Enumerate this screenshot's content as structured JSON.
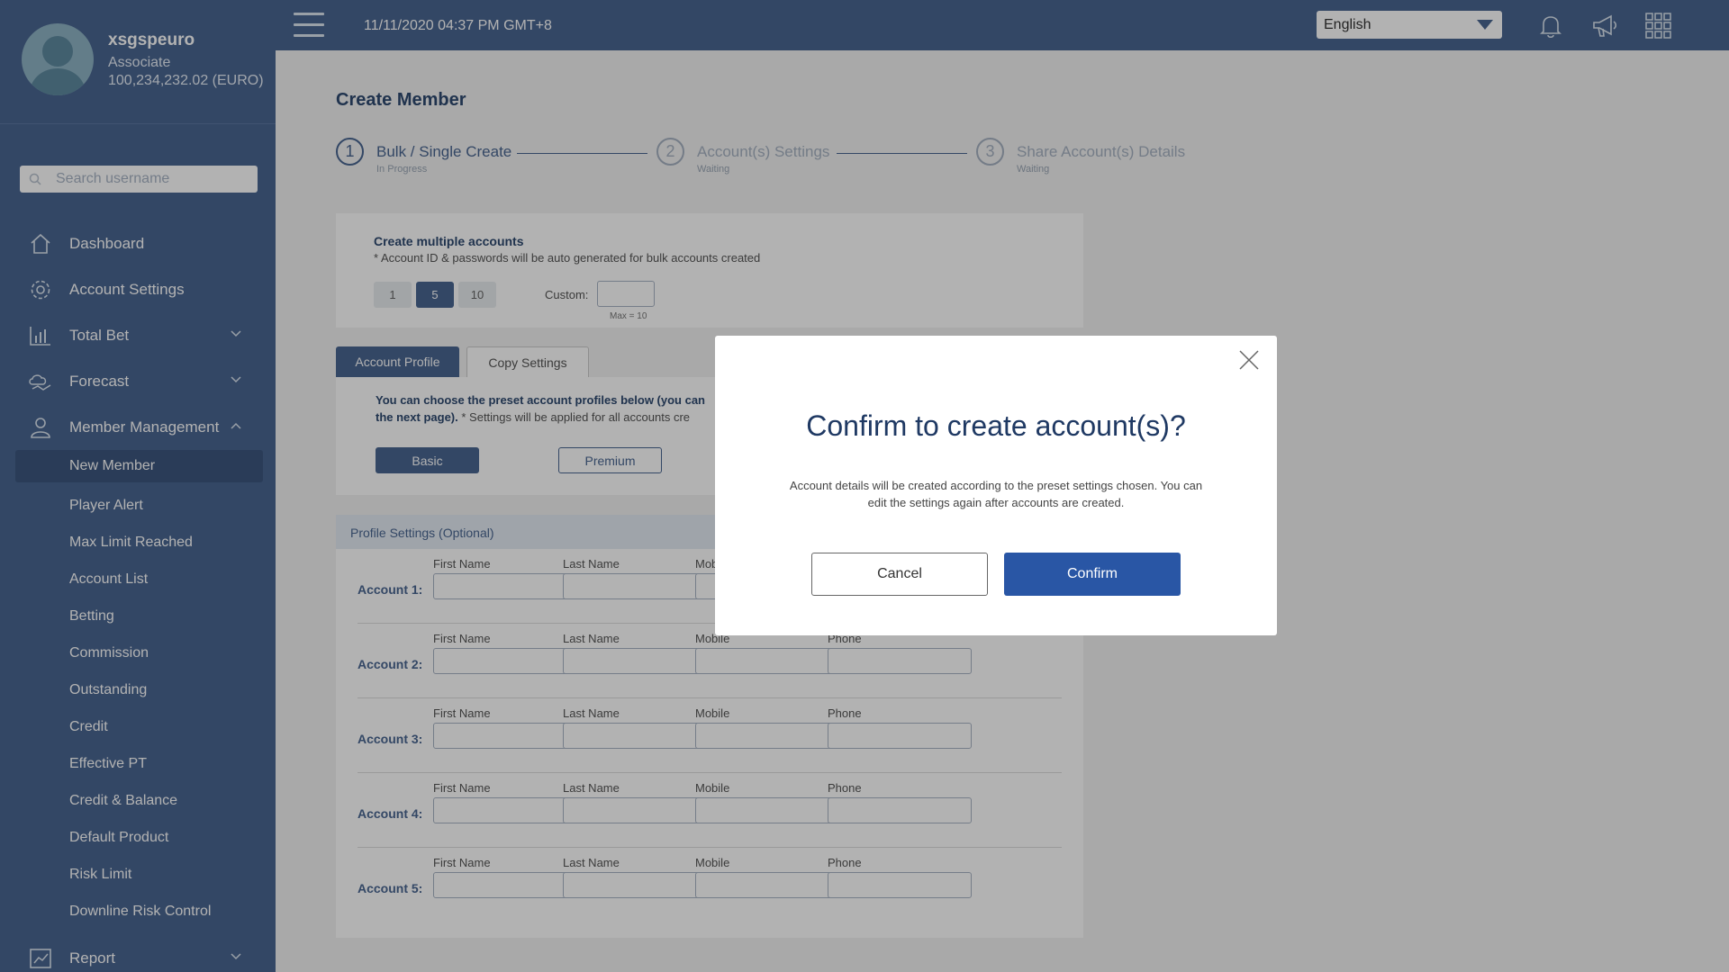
{
  "user": {
    "name": "xsgspeuro",
    "role": "Associate",
    "balance": "100,234,232.02 (EURO)"
  },
  "search": {
    "placeholder": "Search username"
  },
  "nav": {
    "dashboard": "Dashboard",
    "account_settings": "Account Settings",
    "total_bet": "Total Bet",
    "forecast": "Forecast",
    "member_management": "Member Management",
    "report": "Report",
    "sub_items": [
      "New Member",
      "Player Alert",
      "Max Limit Reached",
      "Account List",
      "Betting",
      "Commission",
      "Outstanding",
      "Credit",
      "Effective PT",
      "Credit & Balance",
      "Default Product",
      "Risk Limit",
      "Downline Risk Control"
    ]
  },
  "topbar": {
    "datetime": "11/11/2020 04:37 PM GMT+8",
    "language": "English"
  },
  "page": {
    "title": "Create Member",
    "steps": [
      {
        "number": "1",
        "label": "Bulk / Single Create",
        "status": "In Progress"
      },
      {
        "number": "2",
        "label": "Account(s) Settings",
        "status": "Waiting"
      },
      {
        "number": "3",
        "label": "Share Account(s) Details",
        "status": "Waiting"
      }
    ],
    "bulk": {
      "title": "Create multiple accounts",
      "note": "* Account ID & passwords will be auto generated for bulk accounts created",
      "counts": [
        "1",
        "5",
        "10"
      ],
      "selected_count": "5",
      "custom_label": "Custom:",
      "max_note": "Max = 10"
    },
    "tabs": {
      "profile": "Account Profile",
      "copy": "Copy Settings"
    },
    "profile": {
      "desc_main": "You can choose the preset account profiles below (you can",
      "desc_main2": "the next page).",
      "desc_note": "* Settings will be applied for all accounts cre",
      "basic": "Basic",
      "premium": "Premium"
    },
    "settings": {
      "header": "Profile Settings (Optional)",
      "field_labels": {
        "first": "First Name",
        "last": "Last Name",
        "mobile": "Mobile",
        "phone": "Phone"
      },
      "accounts": [
        "Account 1:",
        "Account 2:",
        "Account 3:",
        "Account 4:",
        "Account 5:"
      ]
    }
  },
  "modal": {
    "title": "Confirm to create account(s)?",
    "body": "Account details will be created according to the preset settings chosen. You can edit the settings again after accounts are created.",
    "cancel": "Cancel",
    "confirm": "Confirm"
  }
}
